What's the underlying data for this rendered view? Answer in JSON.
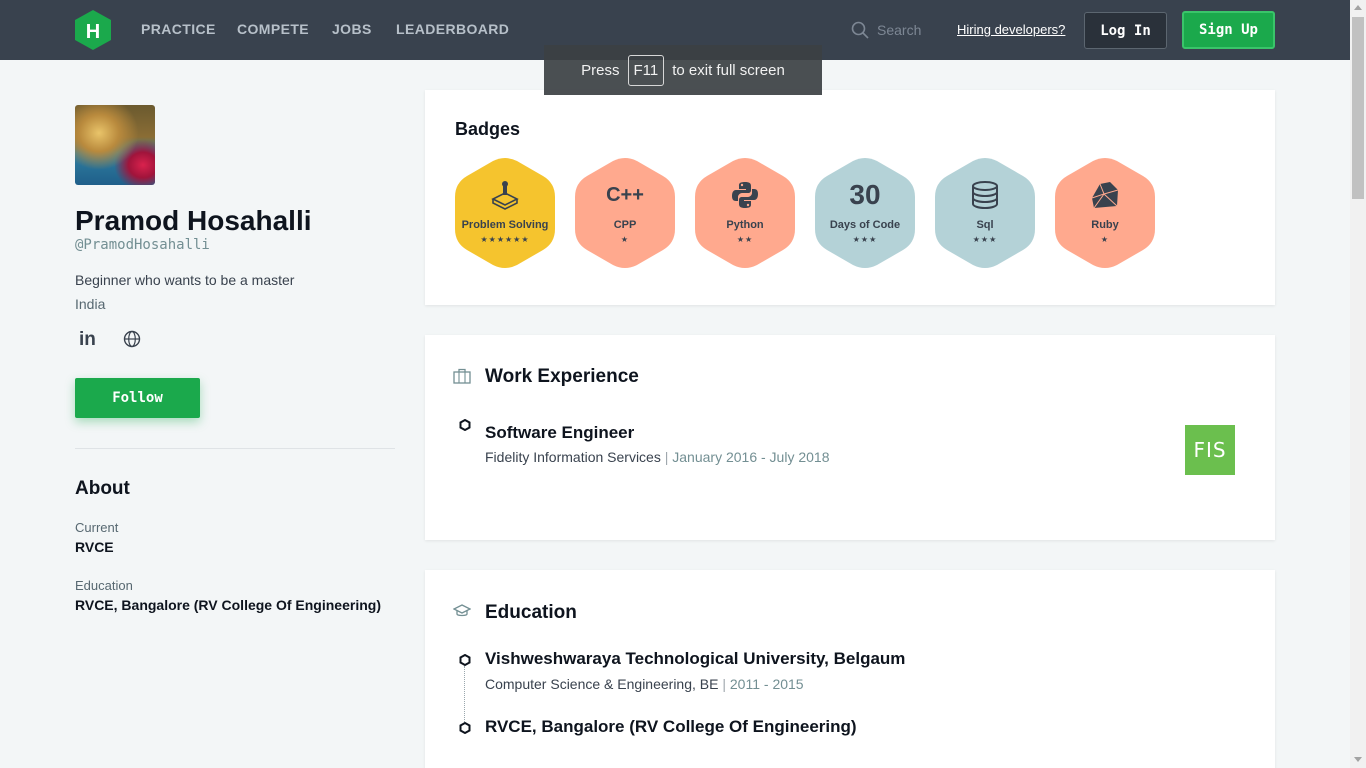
{
  "nav": {
    "links": [
      "PRACTICE",
      "COMPETE",
      "JOBS",
      "LEADERBOARD"
    ],
    "search_placeholder": "Search",
    "hiring_link": "Hiring developers?",
    "login_label": "Log In",
    "signup_label": "Sign Up"
  },
  "fullscreen_notice": {
    "press": "Press",
    "key": "F11",
    "suffix": "to exit full screen"
  },
  "profile": {
    "name": "Pramod Hosahalli",
    "handle": "@PramodHosahalli",
    "bio": "Beginner who wants to be a master",
    "country": "India",
    "linkedin_label": "in",
    "follow_label": "Follow"
  },
  "about": {
    "title": "About",
    "current_label": "Current",
    "current_value": "RVCE",
    "education_label": "Education",
    "education_value": "RVCE, Bangalore (RV College Of Engineering)"
  },
  "badges": {
    "title": "Badges",
    "items": [
      {
        "name": "Problem Solving",
        "icon": "problem-solving-icon",
        "stars": "★★★★★★",
        "star_count": 6,
        "color": "#f5c42e"
      },
      {
        "name": "CPP",
        "icon": "cpp-icon",
        "icon_text": "C++",
        "stars": "★",
        "star_count": 1,
        "color": "#ffa98e"
      },
      {
        "name": "Python",
        "icon": "python-icon",
        "stars": "★★",
        "star_count": 2,
        "color": "#ffa98e"
      },
      {
        "name": "Days of Code",
        "icon": "30-days-icon",
        "icon_text": "30",
        "stars": "★★★",
        "star_count": 3,
        "color": "#b4d2d7"
      },
      {
        "name": "Sql",
        "icon": "database-icon",
        "stars": "★★★",
        "star_count": 3,
        "color": "#b4d2d7"
      },
      {
        "name": "Ruby",
        "icon": "ruby-icon",
        "stars": "★",
        "star_count": 1,
        "color": "#ffa98e"
      }
    ]
  },
  "work": {
    "title": "Work Experience",
    "entries": [
      {
        "role": "Software Engineer",
        "company": "Fidelity Information Services",
        "separator": "|",
        "dates": "January 2016 - July 2018",
        "logo_text": "FIS"
      }
    ]
  },
  "education": {
    "title": "Education",
    "entries": [
      {
        "school": "Vishweshwaraya Technological University, Belgaum",
        "degree": "Computer Science & Engineering, BE",
        "separator": "|",
        "dates": "2011 - 2015"
      },
      {
        "school": "RVCE, Bangalore (RV College Of Engineering)"
      }
    ]
  },
  "colors": {
    "nav_bg": "#39424e",
    "accent_green": "#1ba94c",
    "page_bg": "#f3f6f7"
  }
}
